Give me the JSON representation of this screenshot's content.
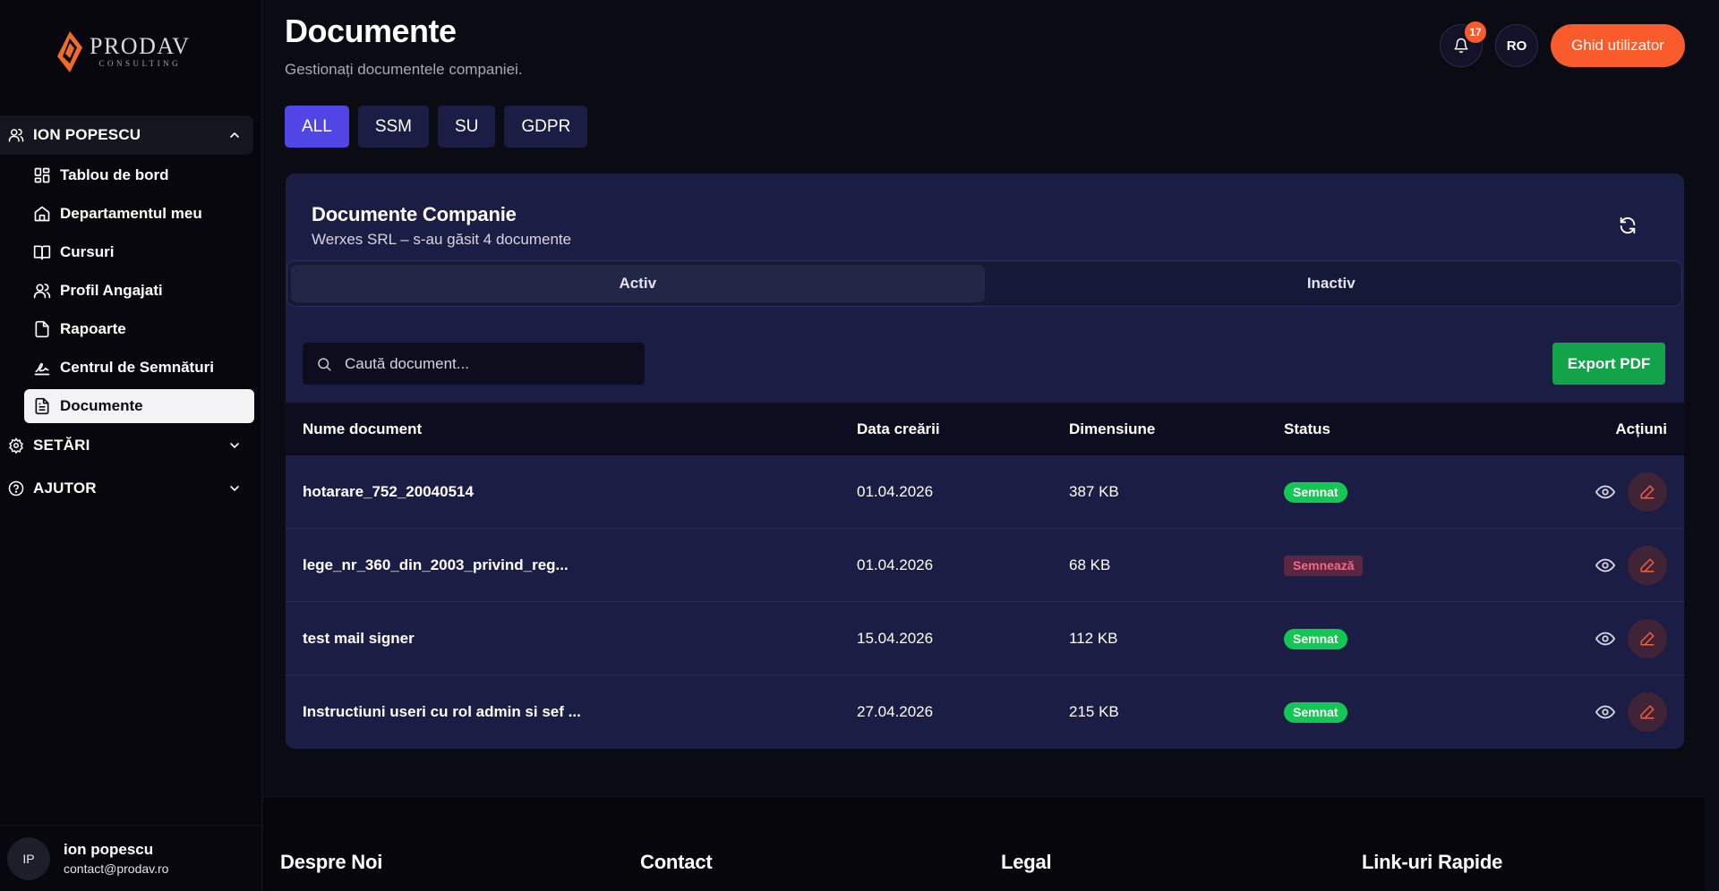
{
  "brand": {
    "name": "PRODAV",
    "tagline": "CONSULTING"
  },
  "sidebar": {
    "user_group": "ION POPESCU",
    "items": [
      {
        "label": "Tablou de bord",
        "icon": "dashboard-icon"
      },
      {
        "label": "Departamentul meu",
        "icon": "home-icon"
      },
      {
        "label": "Cursuri",
        "icon": "book-icon"
      },
      {
        "label": "Profil Angajati",
        "icon": "users-icon"
      },
      {
        "label": "Rapoarte",
        "icon": "file-icon"
      },
      {
        "label": "Centrul de Semnături",
        "icon": "signature-icon"
      },
      {
        "label": "Documente",
        "icon": "document-icon",
        "active": true
      }
    ],
    "settings": "SETĂRI",
    "help": "AJUTOR",
    "footer_user": {
      "initials": "IP",
      "name": "ion popescu",
      "email": "contact@prodav.ro"
    }
  },
  "header": {
    "title": "Documente",
    "subtitle": "Gestionați documentele companiei.",
    "notifications_count": "17",
    "language": "RO",
    "guide_button": "Ghid utilizator"
  },
  "filters": [
    "ALL",
    "SSM",
    "SU",
    "GDPR"
  ],
  "card": {
    "title": "Documente Companie",
    "subtitle": "Werxes SRL – s-au găsit 4 documente",
    "tabs": [
      "Activ",
      "Inactiv"
    ],
    "search_placeholder": "Caută document...",
    "export_button": "Export PDF",
    "columns": [
      "Nume document",
      "Data creării",
      "Dimensiune",
      "Status",
      "Acțiuni"
    ],
    "rows": [
      {
        "name": "hotarare_752_20040514",
        "date": "01.04.2026",
        "size": "387 KB",
        "status": "Semnat",
        "status_type": "ok"
      },
      {
        "name": "lege_nr_360_din_2003_privind_reg...",
        "date": "01.04.2026",
        "size": "68 KB",
        "status": "Semnează",
        "status_type": "warn"
      },
      {
        "name": "test mail signer",
        "date": "15.04.2026",
        "size": "112 KB",
        "status": "Semnat",
        "status_type": "ok"
      },
      {
        "name": "Instructiuni useri cu rol admin si sef ...",
        "date": "27.04.2026",
        "size": "215 KB",
        "status": "Semnat",
        "status_type": "ok"
      }
    ]
  },
  "footer": {
    "columns": [
      "Despre Noi",
      "Contact",
      "Legal",
      "Link-uri Rapide"
    ]
  },
  "colors": {
    "accent": "#f95b2c",
    "primary": "#4f46e5",
    "card_bg": "#1c1d44",
    "success": "#14c653",
    "export_green": "#13a34a"
  }
}
